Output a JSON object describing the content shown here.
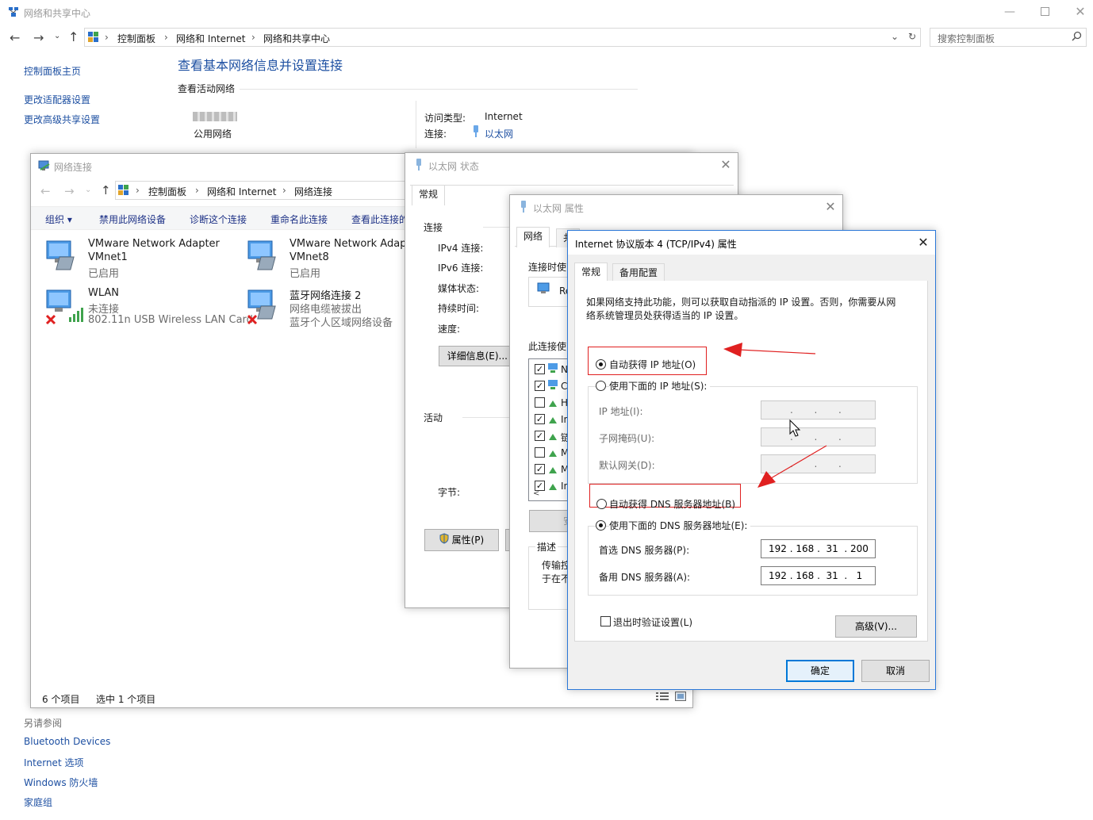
{
  "main_window": {
    "title": "网络和共享中心",
    "breadcrumb": [
      "控制面板",
      "网络和 Internet",
      "网络和共享中心"
    ],
    "search_placeholder": "搜索控制面板",
    "sidebar": {
      "home": "控制面板主页",
      "links": [
        "更改适配器设置",
        "更改高级共享设置"
      ],
      "see_also_title": "另请参阅",
      "see_also": [
        "Bluetooth Devices",
        "Internet 选项",
        "Windows 防火墙",
        "家庭组"
      ]
    },
    "heading": "查看基本网络信息并设置连接",
    "active_networks_label": "查看活动网络",
    "network_type": "公用网络",
    "access_type_label": "访问类型:",
    "access_type_value": "Internet",
    "connection_label": "连接:",
    "connection_value": "以太网"
  },
  "net_connections": {
    "title": "网络连接",
    "breadcrumb": [
      "控制面板",
      "网络和 Internet",
      "网络连接"
    ],
    "toolbar": [
      "组织 ▾",
      "禁用此网络设备",
      "诊断这个连接",
      "重命名此连接",
      "查看此连接的"
    ],
    "adapters": [
      {
        "name": "VMware Network Adapter",
        "line2": "VMnet1",
        "line3": "已启用",
        "status": "enabled"
      },
      {
        "name": "VMware Network Adapte",
        "line2": "VMnet8",
        "line3": "已启用",
        "status": "enabled"
      },
      {
        "name": "WLAN",
        "line2": "未连接",
        "line3": "802.11n USB Wireless LAN Card",
        "status": "disconnected"
      },
      {
        "name": "蓝牙网络连接 2",
        "line2": "网络电缆被拔出",
        "line3": "蓝牙个人区域网络设备",
        "status": "disconnected"
      }
    ],
    "status_count": "6 个项目",
    "status_selected": "选中 1 个项目"
  },
  "eth_status": {
    "title": "以太网 状态",
    "tab": "常规",
    "section_connection": "连接",
    "rows": [
      "IPv4 连接:",
      "IPv6 连接:",
      "媒体状态:",
      "持续时间:",
      "速度:"
    ],
    "details_button": "详细信息(E)...",
    "section_activity": "活动",
    "bytes_label": "字节:",
    "properties_button": "属性(P)"
  },
  "eth_props": {
    "title": "以太网 属性",
    "tabs": [
      "网络",
      "共"
    ],
    "connect_using": "连接时使",
    "adapter_partial": "Re",
    "items_label": "此连接使",
    "items": [
      {
        "checked": true,
        "label": "N"
      },
      {
        "checked": true,
        "label": "C"
      },
      {
        "checked": false,
        "label": "H"
      },
      {
        "checked": true,
        "label": "In"
      },
      {
        "checked": true,
        "label": "链"
      },
      {
        "checked": false,
        "label": "M"
      },
      {
        "checked": true,
        "label": "M"
      },
      {
        "checked": true,
        "label": "In"
      }
    ],
    "install_button": "安",
    "desc_label": "描述",
    "desc_line1": "传输控",
    "desc_line2": "于在不"
  },
  "ipv4": {
    "title": "Internet 协议版本 4 (TCP/IPv4) 属性",
    "tabs": [
      "常规",
      "备用配置"
    ],
    "description": [
      "如果网络支持此功能，则可以获取自动指派的 IP 设置。否则，你需要从网",
      "络系统管理员处获得适当的 IP 设置。"
    ],
    "auto_ip": "自动获得 IP 地址(O)",
    "manual_ip": "使用下面的 IP 地址(S):",
    "ip_label": "IP 地址(I):",
    "mask_label": "子网掩码(U):",
    "gateway_label": "默认网关(D):",
    "empty_ip": ".       .       .",
    "auto_dns": "自动获得 DNS 服务器地址(B)",
    "manual_dns": "使用下面的 DNS 服务器地址(E):",
    "preferred_dns_label": "首选 DNS 服务器(P):",
    "preferred_dns": "192 . 168 .  31  . 200",
    "alternate_dns_label": "备用 DNS 服务器(A):",
    "alternate_dns": "192 . 168 .  31  .   1",
    "validate_label": "退出时验证设置(L)",
    "advanced_button": "高级(V)...",
    "ok_button": "确定",
    "cancel_button": "取消"
  },
  "colors": {
    "link": "#1e50a2",
    "annotation": "#e02020",
    "focus": "#0078d7"
  }
}
